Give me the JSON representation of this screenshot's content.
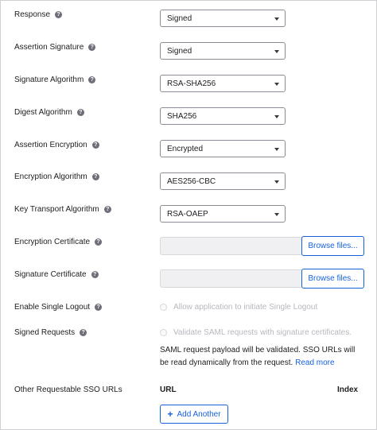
{
  "rows": [
    {
      "label": "Response",
      "value": "Signed"
    },
    {
      "label": "Assertion Signature",
      "value": "Signed"
    },
    {
      "label": "Signature Algorithm",
      "value": "RSA-SHA256"
    },
    {
      "label": "Digest Algorithm",
      "value": "SHA256"
    },
    {
      "label": "Assertion Encryption",
      "value": "Encrypted"
    },
    {
      "label": "Encryption Algorithm",
      "value": "AES256-CBC"
    },
    {
      "label": "Key Transport Algorithm",
      "value": "RSA-OAEP"
    }
  ],
  "certs": [
    {
      "label": "Encryption Certificate",
      "button": "Browse files..."
    },
    {
      "label": "Signature Certificate",
      "button": "Browse files..."
    }
  ],
  "single_logout": {
    "label": "Enable Single Logout",
    "checkbox_text": "Allow application to initiate Single Logout",
    "checked": false
  },
  "signed_requests": {
    "label": "Signed Requests",
    "checkbox_text": "Validate SAML requests with signature certificates.",
    "checked": false,
    "note": "SAML request payload will be validated. SSO URLs will be read dynamically from the request.",
    "read_more": "Read more"
  },
  "sso_urls": {
    "label": "Other Requestable SSO URLs",
    "col_url": "URL",
    "col_index": "Index",
    "add_button": "Add Another"
  },
  "colors": {
    "accent": "#1662dd",
    "help_icon": "#6e6e78"
  }
}
